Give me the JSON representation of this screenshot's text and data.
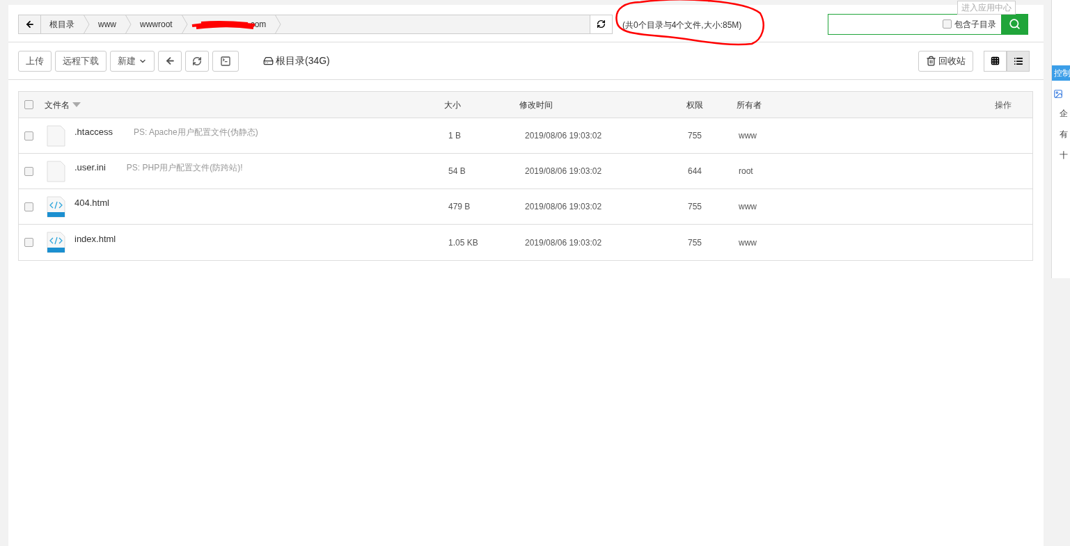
{
  "tooltip": "进入应用中心",
  "breadcrumb": [
    {
      "label": "根目录",
      "redacted": false
    },
    {
      "label": "www",
      "redacted": false
    },
    {
      "label": "wwwroot",
      "redacted": false
    },
    {
      "label": "com",
      "redacted": true
    }
  ],
  "summary": {
    "text": "(共0个目录与4个文件,大小:85M)",
    "circled": true
  },
  "search": {
    "include_subdirs": {
      "label": "包含子目录",
      "checked": false
    }
  },
  "toolbar": [
    {
      "kind": "text",
      "label": "上传"
    },
    {
      "kind": "text",
      "label": "远程下载"
    },
    {
      "kind": "dropdown",
      "label": "新建"
    },
    {
      "kind": "back"
    },
    {
      "kind": "refresh"
    },
    {
      "kind": "terminal"
    }
  ],
  "disk": "根目录(34G)",
  "recycle_bin": "回收站",
  "view_modes": [
    {
      "kind": "grid",
      "selected": false
    },
    {
      "kind": "list",
      "selected": true
    }
  ],
  "table": {
    "select_all": false,
    "columns": [
      "文件名",
      "大小",
      "修改时间",
      "权限",
      "所有者",
      "操作"
    ],
    "rows": [
      {
        "kind": "file",
        "name": ".htaccess",
        "note": "PS: Apache用户配置文件(伪静态)",
        "size": "1 B",
        "modified": "2019/08/06 19:03:02",
        "permissions": "755",
        "owner": "www",
        "checked": false
      },
      {
        "kind": "file",
        "name": ".user.ini",
        "note": "PS: PHP用户配置文件(防跨站)!",
        "size": "54 B",
        "modified": "2019/08/06 19:03:02",
        "permissions": "644",
        "owner": "root",
        "checked": false
      },
      {
        "kind": "html",
        "name": "404.html",
        "size": "479 B",
        "modified": "2019/08/06 19:03:02",
        "permissions": "755",
        "owner": "www",
        "checked": false
      },
      {
        "kind": "html",
        "name": "index.html",
        "size": "1.05 KB",
        "modified": "2019/08/06 19:03:02",
        "permissions": "755",
        "owner": "www",
        "checked": false
      }
    ]
  },
  "side_panel": [
    {
      "kind": "tab",
      "label": "控制"
    },
    {
      "kind": "icon"
    },
    {
      "kind": "text",
      "label": "企"
    },
    {
      "kind": "text",
      "label": "有"
    },
    {
      "kind": "text",
      "label": "十"
    }
  ]
}
